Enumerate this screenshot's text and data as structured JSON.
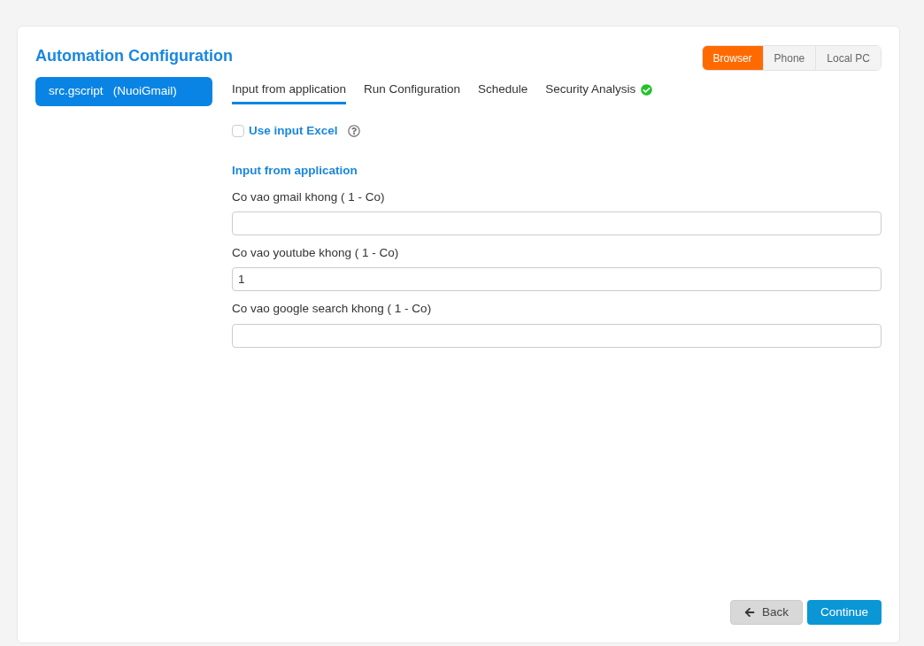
{
  "title": "Automation Configuration",
  "targets": [
    {
      "label": "Browser",
      "selected": true
    },
    {
      "label": "Phone",
      "selected": false
    },
    {
      "label": "Local PC",
      "selected": false
    }
  ],
  "sidebar": {
    "items": [
      {
        "label": "src.gscript   (NuoiGmail)",
        "selected": true
      }
    ]
  },
  "tabs": [
    {
      "label": "Input from application",
      "selected": true,
      "verified": false
    },
    {
      "label": "Run Configuration",
      "selected": false,
      "verified": false
    },
    {
      "label": "Schedule",
      "selected": false,
      "verified": false
    },
    {
      "label": "Security Analysis",
      "selected": false,
      "verified": true
    }
  ],
  "use_excel": {
    "label": "Use input Excel",
    "checked": false
  },
  "section_title": "Input from application",
  "fields": [
    {
      "label": "Co vao gmail khong ( 1 - Co)"
    },
    {
      "label": "Co vao youtube khong ( 1 - Co)",
      "value": "1"
    },
    {
      "label": "Co vao google search khong ( 1 - Co)"
    }
  ],
  "buttons": [
    {
      "kind": "back",
      "label": "Back"
    },
    {
      "kind": "primary",
      "label": "Continue"
    }
  ]
}
